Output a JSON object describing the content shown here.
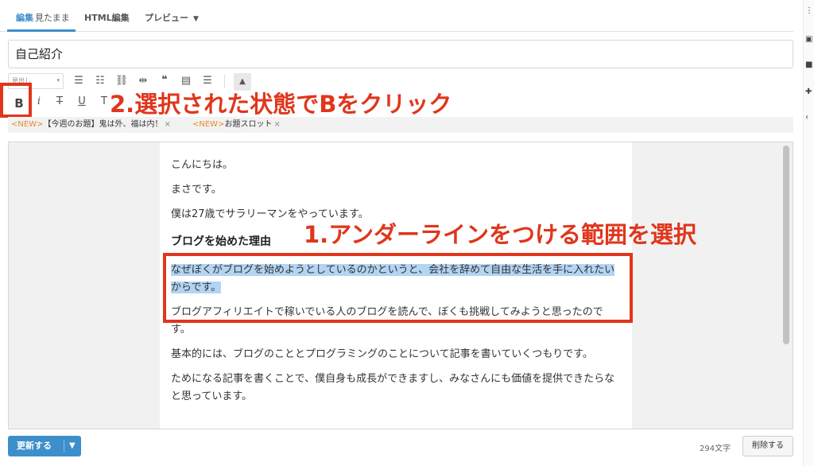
{
  "tabs": {
    "edit_label": "編集",
    "edit_sub": "見たまま",
    "html_label": "HTML編集",
    "preview_label": "プレビュー"
  },
  "title_value": "自己紹介",
  "toolbar": {
    "format_label": "見出し",
    "bold_label": "B"
  },
  "tags": [
    {
      "new": "<NEW>",
      "text": "【今週のお題】鬼は外、福は内！",
      "x": "×"
    },
    {
      "new": "<NEW>",
      "text": "お題スロット",
      "x": "×"
    }
  ],
  "editor": {
    "lines": [
      "こんにちは。",
      "まさです。",
      "僕は27歳でサラリーマンをやっています。"
    ],
    "heading": "ブログを始めた理由",
    "selected_para": "なぜぼくがブログを始めようとしているのかというと、会社を辞めて自由な生活を手に入れたいからです。",
    "para2": "ブログアフィリエイトで稼いでいる人のブログを読んで、ぼくも挑戦してみようと思ったのです。",
    "para3": "基本的には、ブログのこととプログラミングのことについて記事を書いていくつもりです。",
    "para4": "ためになる記事を書くことで、僕自身も成長ができますし、みなさんにも価値を提供できたらなと思っています。"
  },
  "annotations": {
    "step1": "1.アンダーラインをつける範囲を選択",
    "step2": "2.選択された状態でBをクリック",
    "color": "#e0361c"
  },
  "footer": {
    "update_label": "更新する",
    "char_count": "294文字",
    "delete_label": "削除する"
  },
  "colors": {
    "accent": "#3d8fcc",
    "selection": "#b3d4f2",
    "new_tag": "#e88a2c"
  }
}
